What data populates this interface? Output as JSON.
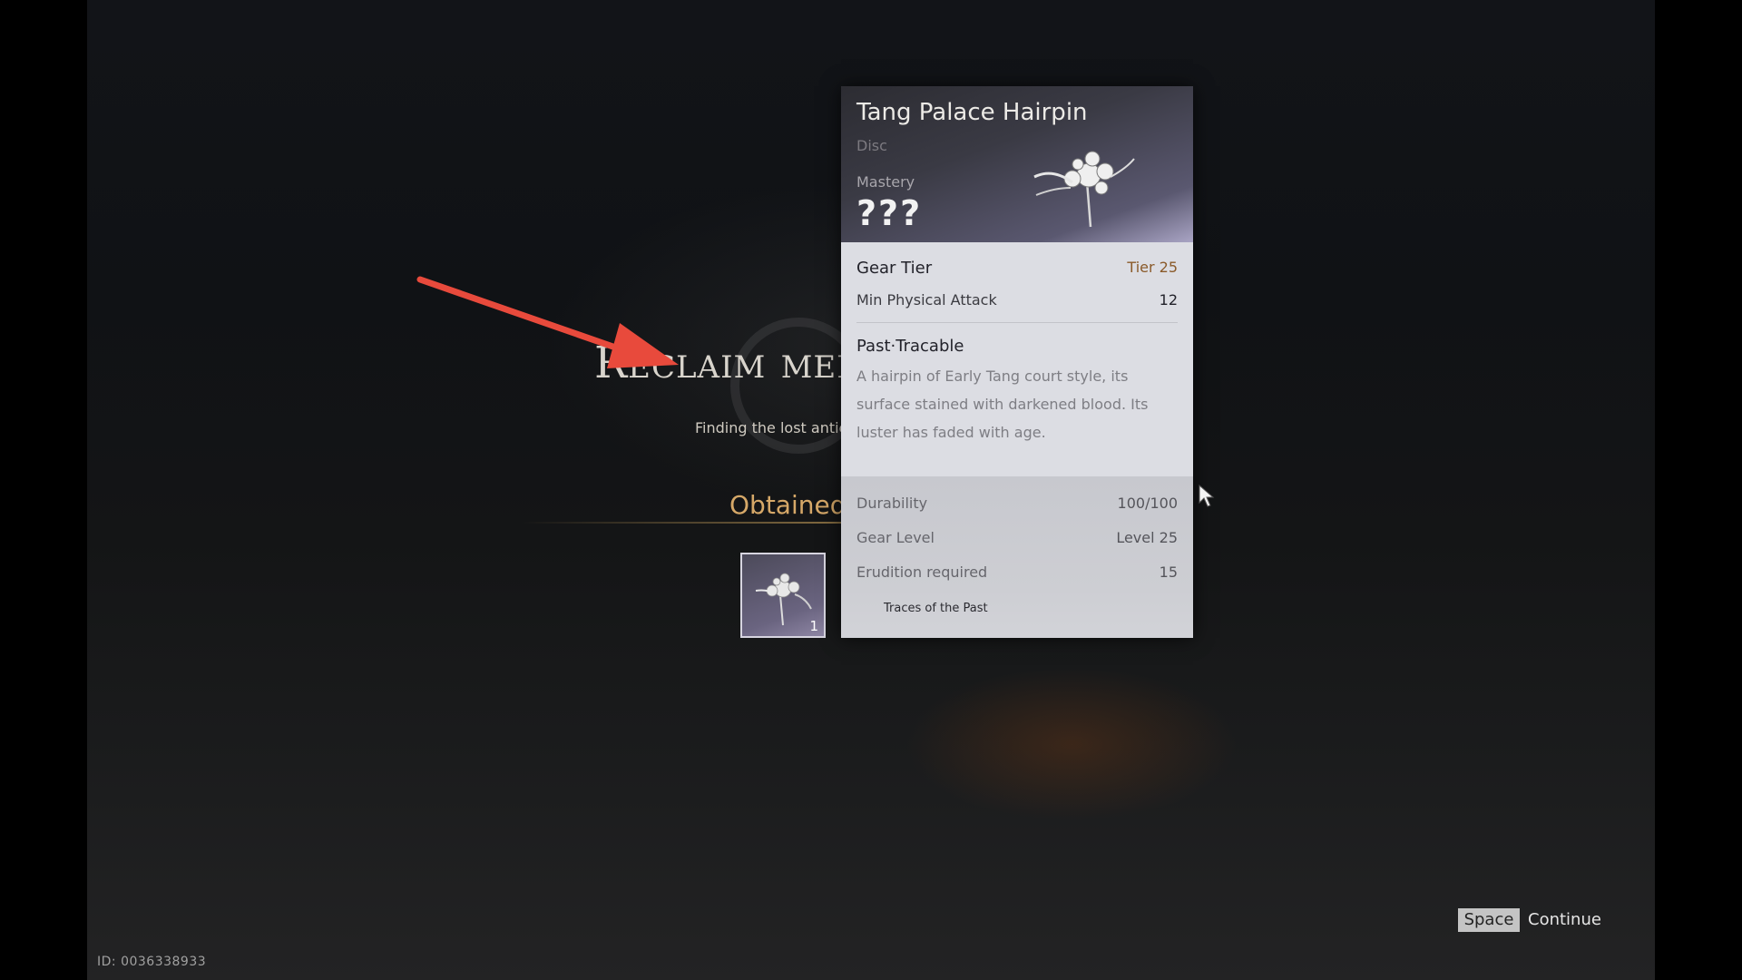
{
  "screen": {
    "title": "Reclaim memories",
    "subtitle": "Finding the lost antic",
    "obtained_label": "Obtained",
    "slot_quantity": "1",
    "slot_icon": "hairpin-icon"
  },
  "tooltip": {
    "name": "Tang Palace Hairpin",
    "type": "Disc",
    "mastery_label": "Mastery",
    "mastery_value": "???",
    "gear_tier_label": "Gear Tier",
    "gear_tier_value": "Tier 25",
    "min_physical_attack_label": "Min Physical Attack",
    "min_physical_attack_value": "12",
    "trait_title": "Past·Tracable",
    "description": "A hairpin of Early Tang court style, its surface stained with darkened blood. Its luster has faded with age.",
    "durability_label": "Durability",
    "durability_value": "100/100",
    "gear_level_label": "Gear Level",
    "gear_level_value": "Level 25",
    "erudition_label": "Erudition required",
    "erudition_value": "15",
    "traces_label": "Traces of the Past",
    "gear_tier_color": "#8a5a2a"
  },
  "footer": {
    "key_label": "Space",
    "action_label": "Continue",
    "id_text": "ID: 0036338933"
  },
  "colors": {
    "annotation_arrow": "#e84a3c",
    "obtained": "#d6a868"
  }
}
